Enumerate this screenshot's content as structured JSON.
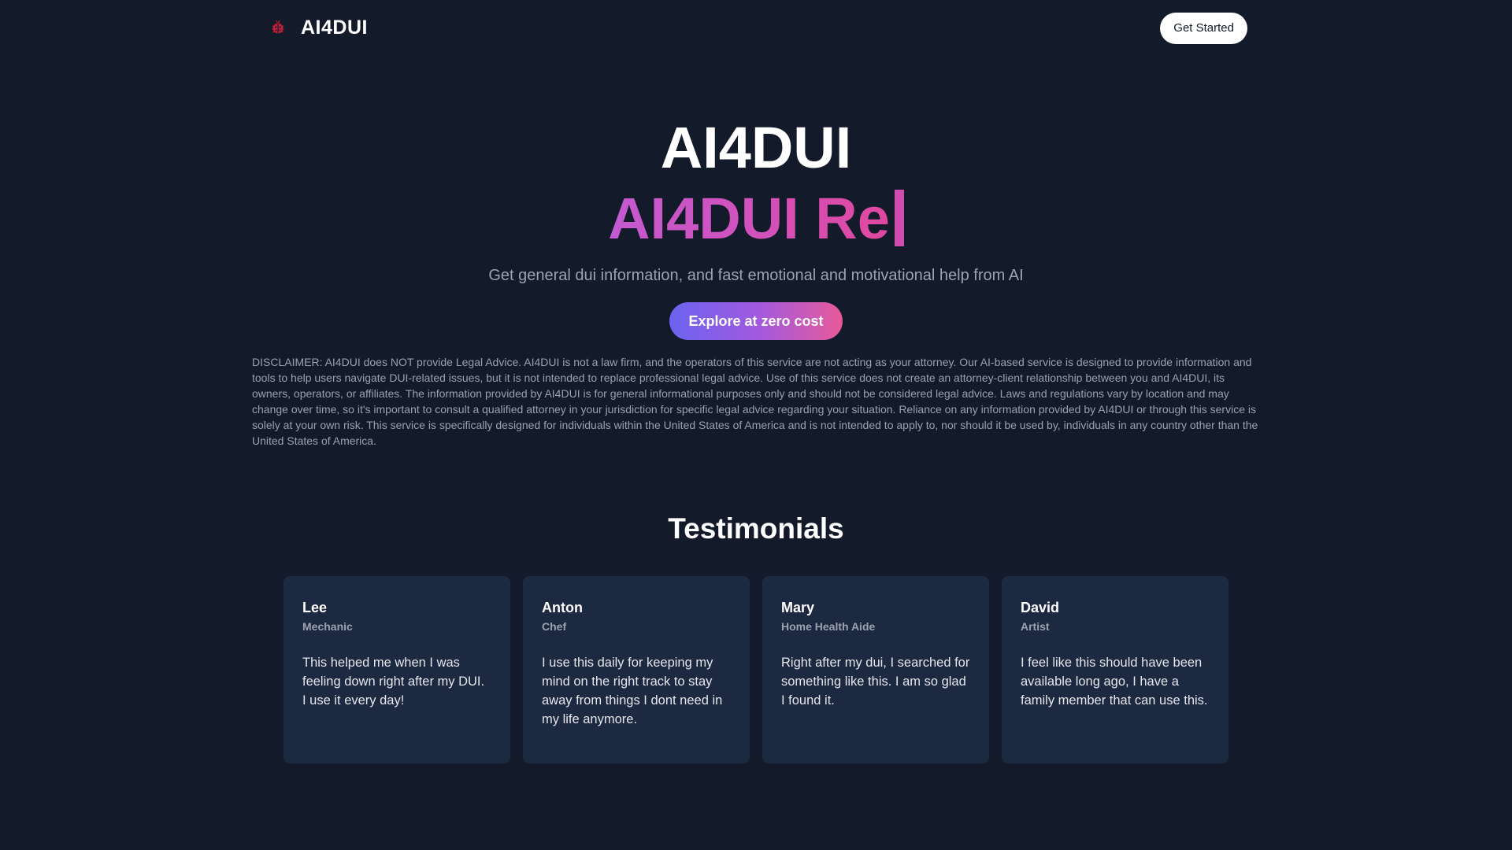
{
  "header": {
    "brand_name": "AI4DUI",
    "logo_icon": "ladybug-icon",
    "get_started_label": "Get Started"
  },
  "hero": {
    "title": "AI4DUI",
    "typed_text": "AI4DUI Re",
    "subtitle": "Get general dui information, and fast emotional and motivational help from AI",
    "cta_label": "Explore at zero cost",
    "disclaimer": "DISCLAIMER: AI4DUI does NOT provide Legal Advice. AI4DUI is not a law firm, and the operators of this service are not acting as your attorney. Our AI-based service is designed to provide information and tools to help users navigate DUI-related issues, but it is not intended to replace professional legal advice. Use of this service does not create an attorney-client relationship between you and AI4DUI, its owners, operators, or affiliates. The information provided by AI4DUI is for general informational purposes only and should not be considered legal advice. Laws and regulations vary by location and may change over time, so it's important to consult a qualified attorney in your jurisdiction for specific legal advice regarding your situation. Reliance on any information provided by AI4DUI or through this service is solely at your own risk. This service is specifically designed for individuals within the United States of America and is not intended to apply to, nor should it be used by, individuals in any country other than the United States of America."
  },
  "testimonials": {
    "heading": "Testimonials",
    "items": [
      {
        "name": "Lee",
        "role": "Mechanic",
        "text": "This helped me when I was feeling down right after my DUI. I use it every day!"
      },
      {
        "name": "Anton",
        "role": "Chef",
        "text": "I use this daily for keeping my mind on the right track to stay away from things I dont need in my life anymore."
      },
      {
        "name": "Mary",
        "role": "Home Health Aide",
        "text": "Right after my dui, I searched for something like this. I am so glad I found it."
      },
      {
        "name": "David",
        "role": "Artist",
        "text": "I feel like this should have been available long ago, I have a family member that can use this."
      }
    ]
  },
  "colors": {
    "background": "#131a2a",
    "card": "#1d2841",
    "accent_gradient_start": "#6c63f0",
    "accent_gradient_end": "#e85a9a",
    "logo_red": "#c0213a"
  }
}
